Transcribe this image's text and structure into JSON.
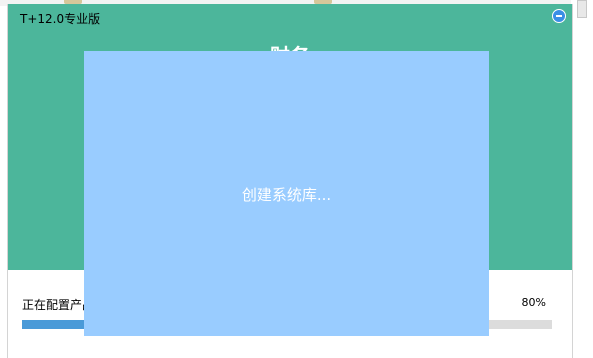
{
  "window": {
    "title": "T+12.0专业版",
    "heading": "财务"
  },
  "progress": {
    "status": "正在配置产品",
    "percent_label": "80%",
    "percent": 80
  },
  "overlay": {
    "message": "创建系统库..."
  },
  "colors": {
    "banner": "#4cb69b",
    "overlay": "#99ccff",
    "progress_fill": "#4a9ad8",
    "progress_track": "#dcdcdc"
  },
  "icons": {
    "minimize": "minimize-icon"
  }
}
